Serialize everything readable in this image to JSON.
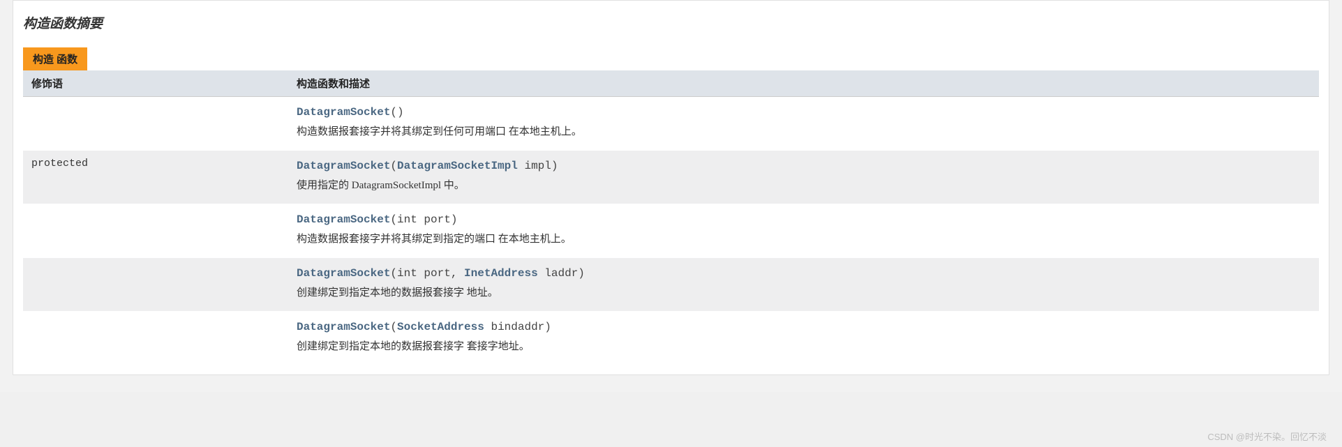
{
  "section_title": "构造函数摘要",
  "tab_label": "构造 函数",
  "columns": {
    "modifier": "修饰语",
    "desc": "构造函数和描述"
  },
  "rows": [
    {
      "modifier": "",
      "sig": [
        {
          "kind": "link",
          "text": "DatagramSocket"
        },
        {
          "kind": "plain",
          "text": "()"
        }
      ],
      "desc": "构造数据报套接字并将其绑定到任何可用端口 在本地主机上。"
    },
    {
      "modifier": "protected ",
      "sig": [
        {
          "kind": "link",
          "text": "DatagramSocket"
        },
        {
          "kind": "plain",
          "text": "("
        },
        {
          "kind": "link",
          "text": "DatagramSocketImpl"
        },
        {
          "kind": "plain",
          "text": " impl)"
        }
      ],
      "desc": "使用指定的 DatagramSocketImpl 中。"
    },
    {
      "modifier": "",
      "sig": [
        {
          "kind": "link",
          "text": "DatagramSocket"
        },
        {
          "kind": "plain",
          "text": "(int port)"
        }
      ],
      "desc": "构造数据报套接字并将其绑定到指定的端口 在本地主机上。"
    },
    {
      "modifier": "",
      "sig": [
        {
          "kind": "link",
          "text": "DatagramSocket"
        },
        {
          "kind": "plain",
          "text": "(int port, "
        },
        {
          "kind": "link",
          "text": "InetAddress"
        },
        {
          "kind": "plain",
          "text": " laddr)"
        }
      ],
      "desc": "创建绑定到指定本地的数据报套接字 地址。"
    },
    {
      "modifier": "",
      "sig": [
        {
          "kind": "link",
          "text": "DatagramSocket"
        },
        {
          "kind": "plain",
          "text": "("
        },
        {
          "kind": "link",
          "text": "SocketAddress"
        },
        {
          "kind": "plain",
          "text": " bindaddr)"
        }
      ],
      "desc": "创建绑定到指定本地的数据报套接字 套接字地址。"
    }
  ],
  "watermark": "CSDN @时光不染。回忆不淡"
}
